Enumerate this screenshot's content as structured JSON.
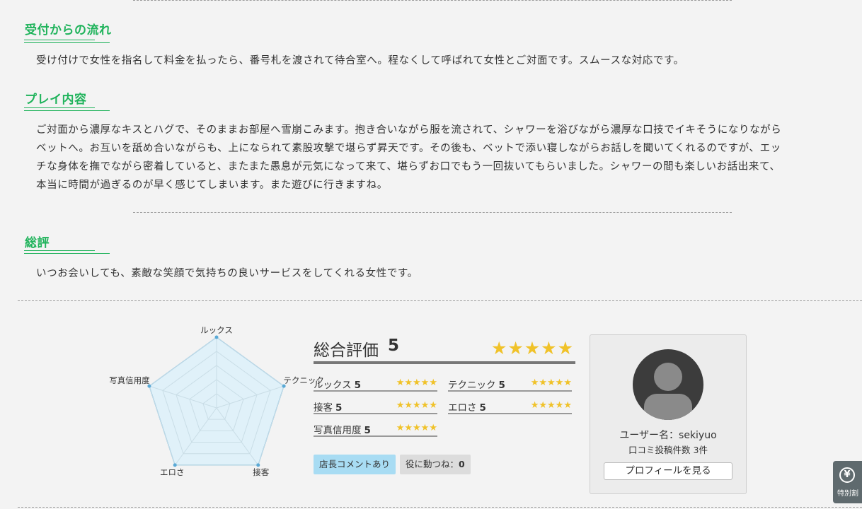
{
  "sections": {
    "flow": {
      "title": "受付からの流れ",
      "text": "受け付けで女性を指名して料金を払ったら、番号札を渡されて待合室へ。程なくして呼ばれて女性とご対面です。スムースな対応です。"
    },
    "play": {
      "title": "プレイ内容",
      "lines": [
        "ご対面から濃厚なキスとハグで、そのままお部屋へ雪崩こみます。抱き合いながら服を流されて、シャワーを浴びながら濃厚な口技でイキそうになりながら",
        "ベットへ。お互いを舐め合いながらも、上になられて素股攻撃で堪らず昇天です。その後も、ベットで添い寝しながらお話しを聞いてくれるのですが、エッ",
        "チな身体を撫でながら密着していると、またまた愚息が元気になって来て、堪らずお口でもう一回抜いてもらいました。シャワーの間も楽しいお話出来て、",
        "本当に時間が過ぎるのが早く感じてしまいます。また遊びに行きますね。"
      ]
    },
    "summary": {
      "title": "総評",
      "text": "いつお会いしても、素敵な笑顔で気持ちの良いサービスをしてくれる女性です。"
    }
  },
  "radar": {
    "labels": [
      "ルックス",
      "テクニック",
      "接客",
      "エロさ",
      "写真信用度"
    ],
    "values": [
      5,
      5,
      5,
      5,
      5
    ],
    "max": 5,
    "fill": "#d9f0fb",
    "stroke": "#5aa9d6"
  },
  "rating": {
    "overall_label": "総合評価",
    "overall_score": "5",
    "overall_stars": "★★★★★",
    "categories": [
      {
        "name": "ルックス",
        "score": "5",
        "stars": "★★★★★"
      },
      {
        "name": "テクニック",
        "score": "5",
        "stars": "★★★★★"
      },
      {
        "name": "接客",
        "score": "5",
        "stars": "★★★★★"
      },
      {
        "name": "エロさ",
        "score": "5",
        "stars": "★★★★★"
      },
      {
        "name": "写真信用度",
        "score": "5",
        "stars": "★★★★★"
      }
    ],
    "star_color": "#f0c229"
  },
  "badges": {
    "manager_comment": "店長コメントあり",
    "useful_label": "役に動つね：",
    "useful_count": "0"
  },
  "profile": {
    "username": "ユーザー名：sekiyuo",
    "post_count": "口コミ投稿件数 3件",
    "button": "プロフィールを見る"
  },
  "special": {
    "icon": "yen-icon",
    "label": "特別割"
  },
  "colors": {
    "accent_green": "#1fb35b",
    "background": "#f3f3f3"
  }
}
